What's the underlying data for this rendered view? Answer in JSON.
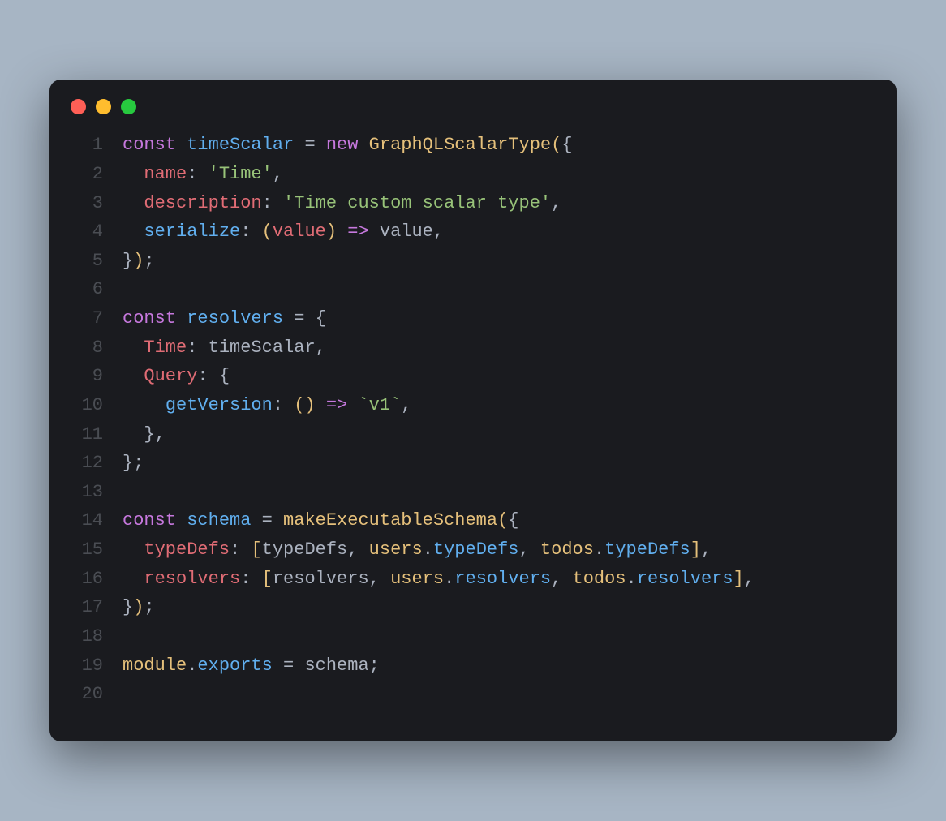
{
  "colors": {
    "red": "#ff5f56",
    "yellow": "#ffbd2e",
    "green": "#27c93f",
    "background": "#1a1b1f",
    "page": "#a7b5c4"
  },
  "lines": [
    {
      "n": "1",
      "tokens": [
        {
          "c": "tok-keyword",
          "t": "const"
        },
        {
          "c": "tok-plain",
          "t": " "
        },
        {
          "c": "tok-def",
          "t": "timeScalar"
        },
        {
          "c": "tok-plain",
          "t": " "
        },
        {
          "c": "tok-op",
          "t": "="
        },
        {
          "c": "tok-plain",
          "t": " "
        },
        {
          "c": "tok-keyword",
          "t": "new"
        },
        {
          "c": "tok-plain",
          "t": " "
        },
        {
          "c": "tok-func",
          "t": "GraphQLScalarType"
        },
        {
          "c": "tok-paren",
          "t": "("
        },
        {
          "c": "tok-punct",
          "t": "{"
        }
      ]
    },
    {
      "n": "2",
      "tokens": [
        {
          "c": "tok-plain",
          "t": "  "
        },
        {
          "c": "tok-property",
          "t": "name"
        },
        {
          "c": "tok-punct",
          "t": ":"
        },
        {
          "c": "tok-plain",
          "t": " "
        },
        {
          "c": "tok-string",
          "t": "'Time'"
        },
        {
          "c": "tok-punct",
          "t": ","
        }
      ]
    },
    {
      "n": "3",
      "tokens": [
        {
          "c": "tok-plain",
          "t": "  "
        },
        {
          "c": "tok-property",
          "t": "description"
        },
        {
          "c": "tok-punct",
          "t": ":"
        },
        {
          "c": "tok-plain",
          "t": " "
        },
        {
          "c": "tok-string",
          "t": "'Time custom scalar type'"
        },
        {
          "c": "tok-punct",
          "t": ","
        }
      ]
    },
    {
      "n": "4",
      "tokens": [
        {
          "c": "tok-plain",
          "t": "  "
        },
        {
          "c": "tok-def",
          "t": "serialize"
        },
        {
          "c": "tok-punct",
          "t": ":"
        },
        {
          "c": "tok-plain",
          "t": " "
        },
        {
          "c": "tok-paren",
          "t": "("
        },
        {
          "c": "tok-property",
          "t": "value"
        },
        {
          "c": "tok-paren",
          "t": ")"
        },
        {
          "c": "tok-plain",
          "t": " "
        },
        {
          "c": "tok-arrow",
          "t": "=>"
        },
        {
          "c": "tok-plain",
          "t": " "
        },
        {
          "c": "tok-plain",
          "t": "value"
        },
        {
          "c": "tok-punct",
          "t": ","
        }
      ]
    },
    {
      "n": "5",
      "tokens": [
        {
          "c": "tok-punct",
          "t": "}"
        },
        {
          "c": "tok-paren",
          "t": ")"
        },
        {
          "c": "tok-punct",
          "t": ";"
        }
      ]
    },
    {
      "n": "6",
      "tokens": []
    },
    {
      "n": "7",
      "tokens": [
        {
          "c": "tok-keyword",
          "t": "const"
        },
        {
          "c": "tok-plain",
          "t": " "
        },
        {
          "c": "tok-def",
          "t": "resolvers"
        },
        {
          "c": "tok-plain",
          "t": " "
        },
        {
          "c": "tok-op",
          "t": "="
        },
        {
          "c": "tok-plain",
          "t": " "
        },
        {
          "c": "tok-punct",
          "t": "{"
        }
      ]
    },
    {
      "n": "8",
      "tokens": [
        {
          "c": "tok-plain",
          "t": "  "
        },
        {
          "c": "tok-property",
          "t": "Time"
        },
        {
          "c": "tok-punct",
          "t": ":"
        },
        {
          "c": "tok-plain",
          "t": " "
        },
        {
          "c": "tok-plain",
          "t": "timeScalar"
        },
        {
          "c": "tok-punct",
          "t": ","
        }
      ]
    },
    {
      "n": "9",
      "tokens": [
        {
          "c": "tok-plain",
          "t": "  "
        },
        {
          "c": "tok-property",
          "t": "Query"
        },
        {
          "c": "tok-punct",
          "t": ":"
        },
        {
          "c": "tok-plain",
          "t": " "
        },
        {
          "c": "tok-punct",
          "t": "{"
        }
      ]
    },
    {
      "n": "10",
      "tokens": [
        {
          "c": "tok-plain",
          "t": "    "
        },
        {
          "c": "tok-def",
          "t": "getVersion"
        },
        {
          "c": "tok-punct",
          "t": ":"
        },
        {
          "c": "tok-plain",
          "t": " "
        },
        {
          "c": "tok-paren",
          "t": "()"
        },
        {
          "c": "tok-plain",
          "t": " "
        },
        {
          "c": "tok-arrow",
          "t": "=>"
        },
        {
          "c": "tok-plain",
          "t": " "
        },
        {
          "c": "tok-string",
          "t": "`v1`"
        },
        {
          "c": "tok-punct",
          "t": ","
        }
      ]
    },
    {
      "n": "11",
      "tokens": [
        {
          "c": "tok-plain",
          "t": "  "
        },
        {
          "c": "tok-punct",
          "t": "},"
        }
      ]
    },
    {
      "n": "12",
      "tokens": [
        {
          "c": "tok-punct",
          "t": "};"
        }
      ]
    },
    {
      "n": "13",
      "tokens": []
    },
    {
      "n": "14",
      "tokens": [
        {
          "c": "tok-keyword",
          "t": "const"
        },
        {
          "c": "tok-plain",
          "t": " "
        },
        {
          "c": "tok-def",
          "t": "schema"
        },
        {
          "c": "tok-plain",
          "t": " "
        },
        {
          "c": "tok-op",
          "t": "="
        },
        {
          "c": "tok-plain",
          "t": " "
        },
        {
          "c": "tok-func",
          "t": "makeExecutableSchema"
        },
        {
          "c": "tok-paren",
          "t": "("
        },
        {
          "c": "tok-punct",
          "t": "{"
        }
      ]
    },
    {
      "n": "15",
      "tokens": [
        {
          "c": "tok-plain",
          "t": "  "
        },
        {
          "c": "tok-property",
          "t": "typeDefs"
        },
        {
          "c": "tok-punct",
          "t": ":"
        },
        {
          "c": "tok-plain",
          "t": " "
        },
        {
          "c": "tok-paren",
          "t": "["
        },
        {
          "c": "tok-plain",
          "t": "typeDefs"
        },
        {
          "c": "tok-punct",
          "t": ","
        },
        {
          "c": "tok-plain",
          "t": " "
        },
        {
          "c": "tok-var",
          "t": "users"
        },
        {
          "c": "tok-punct",
          "t": "."
        },
        {
          "c": "tok-def",
          "t": "typeDefs"
        },
        {
          "c": "tok-punct",
          "t": ","
        },
        {
          "c": "tok-plain",
          "t": " "
        },
        {
          "c": "tok-var",
          "t": "todos"
        },
        {
          "c": "tok-punct",
          "t": "."
        },
        {
          "c": "tok-def",
          "t": "typeDefs"
        },
        {
          "c": "tok-paren",
          "t": "]"
        },
        {
          "c": "tok-punct",
          "t": ","
        }
      ]
    },
    {
      "n": "16",
      "tokens": [
        {
          "c": "tok-plain",
          "t": "  "
        },
        {
          "c": "tok-property",
          "t": "resolvers"
        },
        {
          "c": "tok-punct",
          "t": ":"
        },
        {
          "c": "tok-plain",
          "t": " "
        },
        {
          "c": "tok-paren",
          "t": "["
        },
        {
          "c": "tok-plain",
          "t": "resolvers"
        },
        {
          "c": "tok-punct",
          "t": ","
        },
        {
          "c": "tok-plain",
          "t": " "
        },
        {
          "c": "tok-var",
          "t": "users"
        },
        {
          "c": "tok-punct",
          "t": "."
        },
        {
          "c": "tok-def",
          "t": "resolvers"
        },
        {
          "c": "tok-punct",
          "t": ","
        },
        {
          "c": "tok-plain",
          "t": " "
        },
        {
          "c": "tok-var",
          "t": "todos"
        },
        {
          "c": "tok-punct",
          "t": "."
        },
        {
          "c": "tok-def",
          "t": "resolvers"
        },
        {
          "c": "tok-paren",
          "t": "]"
        },
        {
          "c": "tok-punct",
          "t": ","
        }
      ]
    },
    {
      "n": "17",
      "tokens": [
        {
          "c": "tok-punct",
          "t": "}"
        },
        {
          "c": "tok-paren",
          "t": ")"
        },
        {
          "c": "tok-punct",
          "t": ";"
        }
      ]
    },
    {
      "n": "18",
      "tokens": []
    },
    {
      "n": "19",
      "tokens": [
        {
          "c": "tok-var",
          "t": "module"
        },
        {
          "c": "tok-punct",
          "t": "."
        },
        {
          "c": "tok-def",
          "t": "exports"
        },
        {
          "c": "tok-plain",
          "t": " "
        },
        {
          "c": "tok-op",
          "t": "="
        },
        {
          "c": "tok-plain",
          "t": " "
        },
        {
          "c": "tok-plain",
          "t": "schema"
        },
        {
          "c": "tok-punct",
          "t": ";"
        }
      ]
    },
    {
      "n": "20",
      "tokens": []
    }
  ]
}
